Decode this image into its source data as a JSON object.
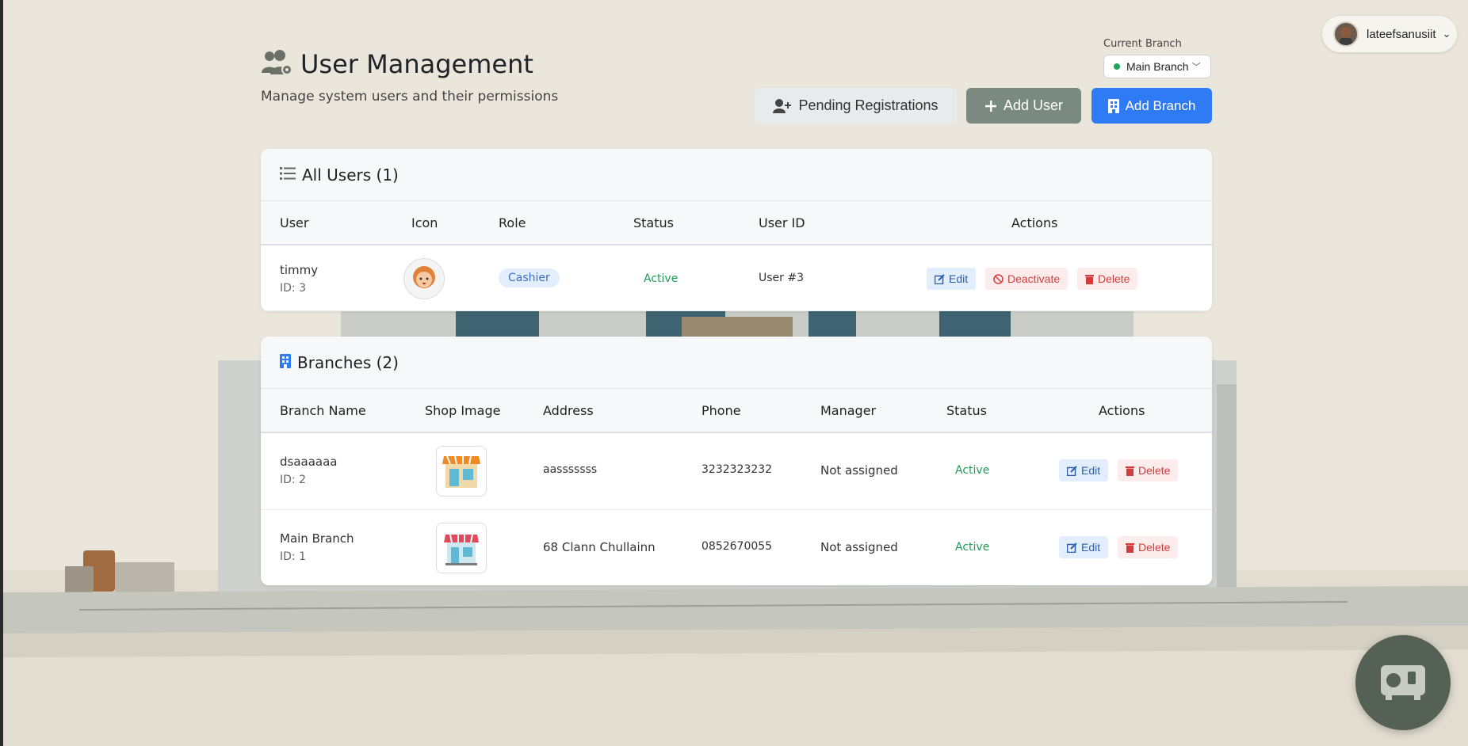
{
  "user_menu": {
    "username": "lateefsanusiit"
  },
  "header": {
    "title": "User Management",
    "subtitle": "Manage system users and their permissions",
    "current_branch_label": "Current Branch",
    "current_branch_value": "Main Branch"
  },
  "actions": {
    "pending": "Pending Registrations",
    "add_user": "Add User",
    "add_branch": "Add Branch"
  },
  "users_card": {
    "title": "All Users (1)",
    "columns": [
      "User",
      "Icon",
      "Role",
      "Status",
      "User ID",
      "Actions"
    ],
    "rows": [
      {
        "name": "timmy",
        "id": "ID: 3",
        "role": "Cashier",
        "status": "Active",
        "user_id": "User #3",
        "edit": "Edit",
        "deactivate": "Deactivate",
        "delete": "Delete"
      }
    ]
  },
  "branches_card": {
    "title": "Branches (2)",
    "columns": [
      "Branch Name",
      "Shop Image",
      "Address",
      "Phone",
      "Manager",
      "Status",
      "Actions"
    ],
    "rows": [
      {
        "name": "dsaaaaaa",
        "id": "ID: 2",
        "address": "aasssssss",
        "phone": "3232323232",
        "manager": "Not assigned",
        "status": "Active",
        "edit": "Edit",
        "delete": "Delete"
      },
      {
        "name": "Main Branch",
        "id": "ID: 1",
        "address": "68 Clann Chullainn",
        "phone": "0852670055",
        "manager": "Not assigned",
        "status": "Active",
        "edit": "Edit",
        "delete": "Delete"
      }
    ]
  },
  "colors": {
    "primary": "#2f7bf5",
    "secondary": "#7b8a80",
    "success": "#1f9d55",
    "danger": "#d43b3b"
  }
}
